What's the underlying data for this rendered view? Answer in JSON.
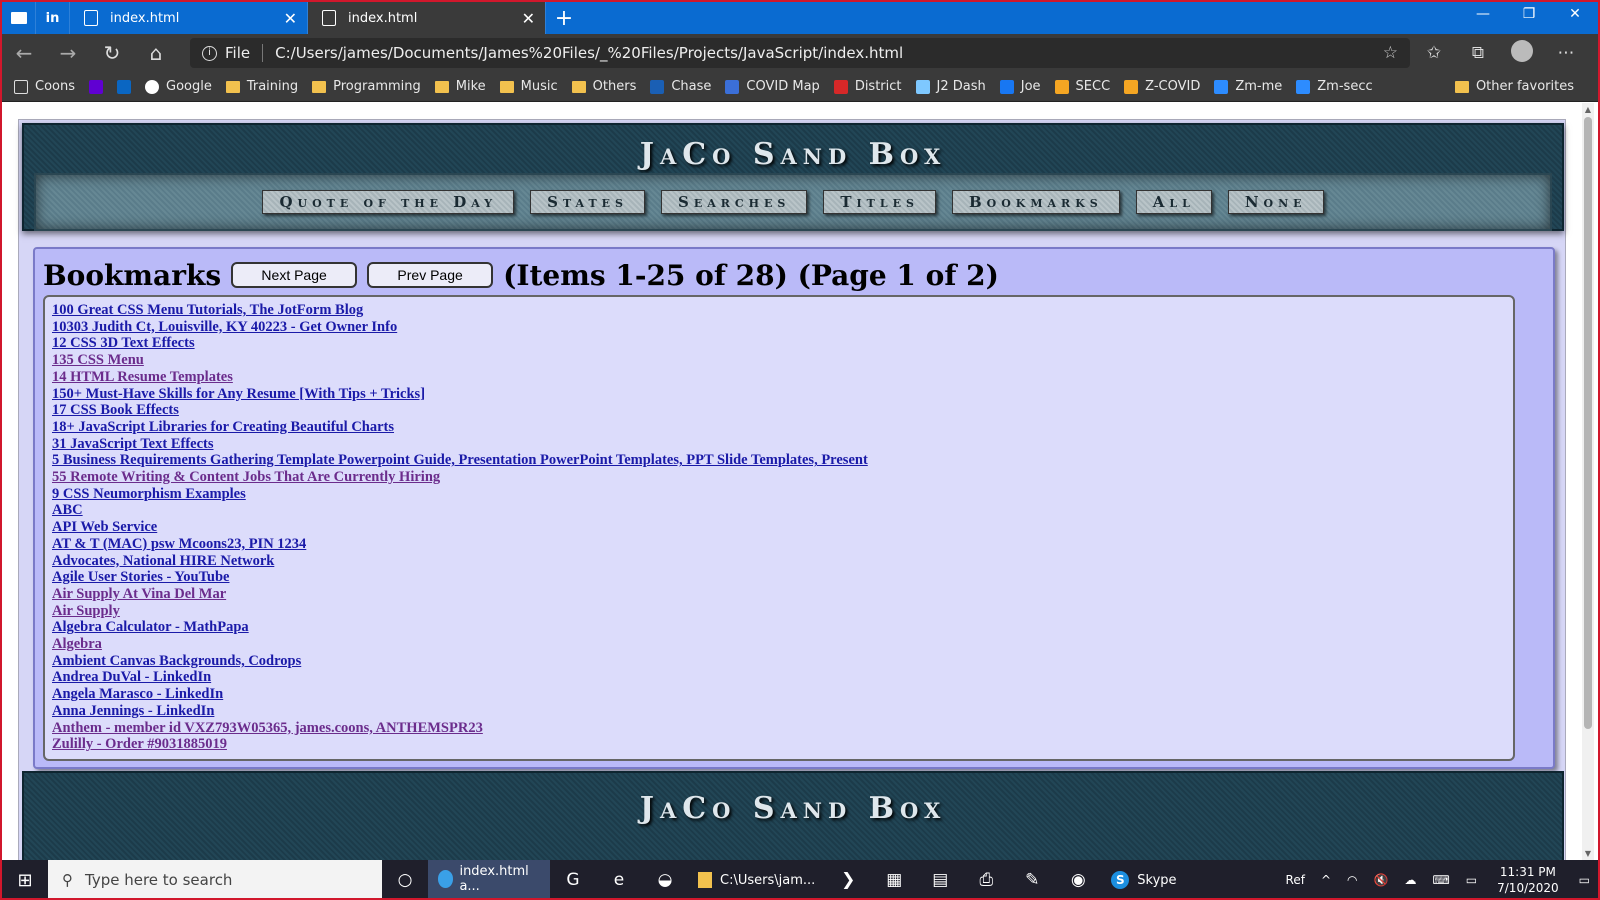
{
  "browser": {
    "tabs": [
      {
        "title": "index.html",
        "active": false
      },
      {
        "title": "index.html",
        "active": true
      }
    ],
    "address": {
      "scheme_label": "File",
      "url": "C:/Users/james/Documents/James%20Files/_%20Files/Projects/JavaScript/index.html"
    },
    "bookmarks": [
      {
        "label": "Coons",
        "icon": "page-icon"
      },
      {
        "label": "",
        "icon": "yahoo-icon"
      },
      {
        "label": "",
        "icon": "linkedin-icon"
      },
      {
        "label": "Google",
        "icon": "google-icon"
      },
      {
        "label": "Training",
        "icon": "folder-icon"
      },
      {
        "label": "Programming",
        "icon": "folder-icon"
      },
      {
        "label": "Mike",
        "icon": "folder-icon"
      },
      {
        "label": "Music",
        "icon": "folder-icon"
      },
      {
        "label": "Others",
        "icon": "folder-icon"
      },
      {
        "label": "Chase",
        "icon": "chase-icon"
      },
      {
        "label": "COVID Map",
        "icon": "map-icon"
      },
      {
        "label": "District",
        "icon": "district-icon"
      },
      {
        "label": "J2 Dash",
        "icon": "globe-icon"
      },
      {
        "label": "Joe",
        "icon": "facebook-icon"
      },
      {
        "label": "SECC",
        "icon": "secc-icon"
      },
      {
        "label": "Z-COVID",
        "icon": "zcovid-icon"
      },
      {
        "label": "Zm-me",
        "icon": "zoom-icon"
      },
      {
        "label": "Zm-secc",
        "icon": "zoom-icon"
      }
    ],
    "other_favorites": "Other favorites"
  },
  "site": {
    "title": "JaCo Sand Box",
    "menu": [
      "Quote of the Day",
      "States",
      "Searches",
      "Titles",
      "Bookmarks",
      "All",
      "None"
    ]
  },
  "bookmarks_panel": {
    "heading": "Bookmarks",
    "next_label": "Next Page",
    "prev_label": "Prev Page",
    "count_text": "(Items 1-25 of 28) (Page 1 of 2)",
    "items": [
      "100 Great CSS Menu Tutorials, The JotForm Blog",
      "10303 Judith Ct, Louisville, KY 40223 - Get Owner Info",
      "12 CSS 3D Text Effects",
      "135 CSS Menu",
      "14 HTML Resume Templates",
      "150+ Must-Have Skills for Any Resume [With Tips + Tricks]",
      "17 CSS Book Effects",
      "18+ JavaScript Libraries for Creating Beautiful Charts",
      "31 JavaScript Text Effects",
      "5 Business Requirements Gathering Template Powerpoint Guide, Presentation PowerPoint Templates, PPT Slide Templates, Present",
      "55 Remote Writing & Content Jobs That Are Currently Hiring",
      "9 CSS Neumorphism Examples",
      "ABC",
      "API Web Service",
      "AT & T (MAC) psw Mcoons23, PIN 1234",
      "Advocates, National HIRE Network",
      "Agile User Stories - YouTube",
      "Air Supply At Vina Del Mar",
      "Air Supply",
      "Algebra Calculator - MathPapa",
      "Algebra",
      "Ambient Canvas Backgrounds, Codrops",
      "Andrea DuVal - LinkedIn",
      "Angela Marasco - LinkedIn",
      "Anna Jennings - LinkedIn",
      "Anthem - member id VXZ793W05365, james.coons, ANTHEMSPR23",
      "Zulilly - Order #9031885019"
    ]
  },
  "footer": {
    "title": "JaCo Sand Box"
  },
  "taskbar": {
    "search_placeholder": "Type here to search",
    "apps": [
      {
        "label": "index.html a...",
        "icon": "edge-icon",
        "active": true
      },
      {
        "label": "C:\\Users\\jam...",
        "icon": "folder-icon",
        "active": false
      },
      {
        "label": "Skype",
        "icon": "skype-icon",
        "active": false
      }
    ],
    "tray_ref": "Ref",
    "time": "11:31 PM",
    "date": "7/10/2020"
  },
  "colors": {
    "tab_bar": "#0a6bd1",
    "page_bg": "#d6d6f6",
    "panel_bg": "#babaf8",
    "link": "#1a1aa8",
    "visited_link": "#6b2c8c",
    "banner": "#1c3b4a"
  }
}
